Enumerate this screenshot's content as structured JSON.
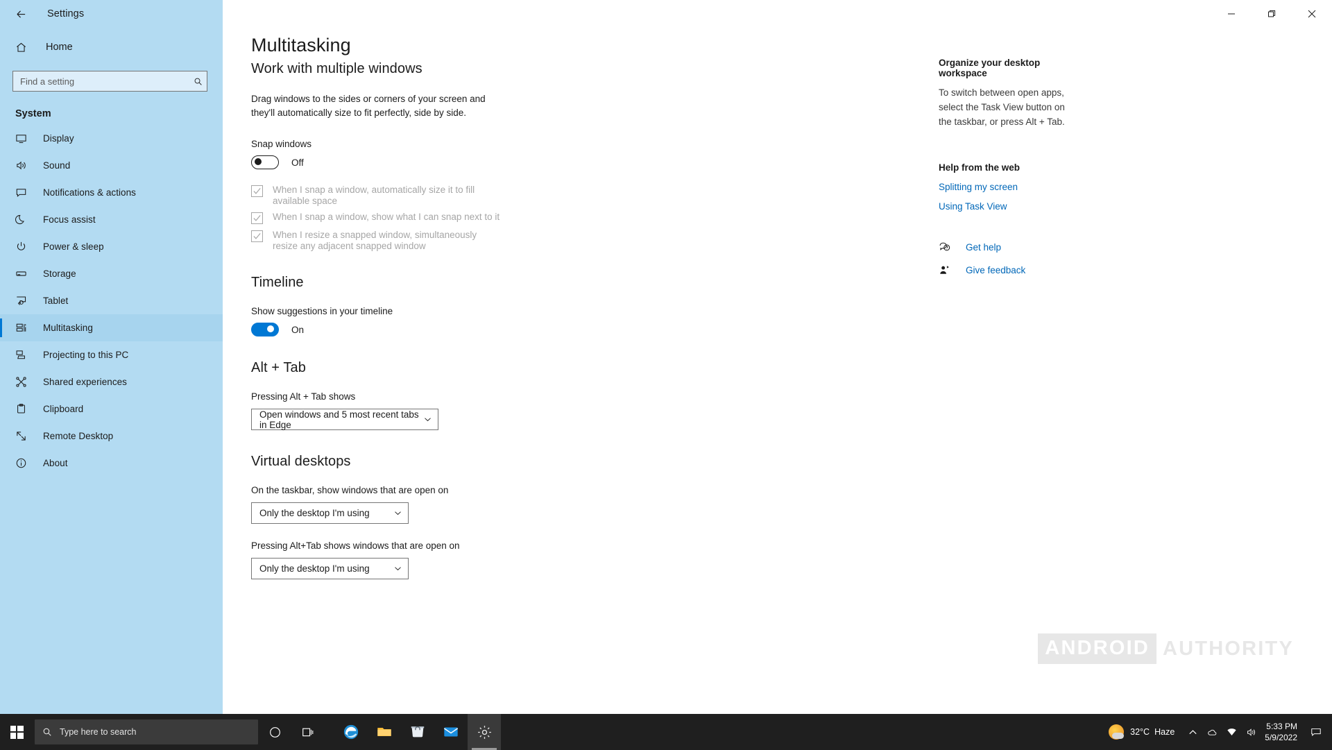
{
  "window": {
    "title": "Settings",
    "back_icon": "back-arrow-icon",
    "minimize_label": "Minimize",
    "restore_label": "Restore",
    "close_label": "Close"
  },
  "sidebar": {
    "home_label": "Home",
    "home_icon": "home-icon",
    "search": {
      "placeholder": "Find a setting",
      "value": "",
      "icon": "search-icon"
    },
    "group_title": "System",
    "items": [
      {
        "label": "Display",
        "icon": "monitor-icon",
        "selected": false
      },
      {
        "label": "Sound",
        "icon": "speaker-icon",
        "selected": false
      },
      {
        "label": "Notifications & actions",
        "icon": "notification-icon",
        "selected": false
      },
      {
        "label": "Focus assist",
        "icon": "moon-icon",
        "selected": false
      },
      {
        "label": "Power & sleep",
        "icon": "power-icon",
        "selected": false
      },
      {
        "label": "Storage",
        "icon": "storage-icon",
        "selected": false
      },
      {
        "label": "Tablet",
        "icon": "tablet-icon",
        "selected": false
      },
      {
        "label": "Multitasking",
        "icon": "multitasking-icon",
        "selected": true
      },
      {
        "label": "Projecting to this PC",
        "icon": "projecting-icon",
        "selected": false
      },
      {
        "label": "Shared experiences",
        "icon": "share-icon",
        "selected": false
      },
      {
        "label": "Clipboard",
        "icon": "clipboard-icon",
        "selected": false
      },
      {
        "label": "Remote Desktop",
        "icon": "remote-desktop-icon",
        "selected": false
      },
      {
        "label": "About",
        "icon": "info-icon",
        "selected": false
      }
    ]
  },
  "page": {
    "title": "Multitasking",
    "sections": {
      "work_with_multiple_windows": {
        "heading": "Work with multiple windows",
        "description": "Drag windows to the sides or corners of your screen and they'll automatically size to fit perfectly, side by side.",
        "snap_label": "Snap windows",
        "snap_state": "Off",
        "snap_on": false,
        "checkboxes": [
          {
            "label": "When I snap a window, automatically size it to fill available space",
            "checked": true,
            "disabled": true
          },
          {
            "label": "When I snap a window, show what I can snap next to it",
            "checked": true,
            "disabled": true
          },
          {
            "label": "When I resize a snapped window, simultaneously resize any adjacent snapped window",
            "checked": true,
            "disabled": true
          }
        ]
      },
      "timeline": {
        "heading": "Timeline",
        "label": "Show suggestions in your timeline",
        "state": "On",
        "on": true
      },
      "alt_tab": {
        "heading": "Alt + Tab",
        "label": "Pressing Alt + Tab shows",
        "value": "Open windows and 5 most recent tabs in Edge",
        "chevron_icon": "chevron-down-icon"
      },
      "virtual_desktops": {
        "heading": "Virtual desktops",
        "taskbar_label": "On the taskbar, show windows that are open on",
        "taskbar_value": "Only the desktop I'm using",
        "alttab_label": "Pressing Alt+Tab shows windows that are open on",
        "alttab_value": "Only the desktop I'm using",
        "chevron_icon": "chevron-down-icon"
      }
    }
  },
  "help_panel": {
    "heading": "Organize your desktop workspace",
    "body": "To switch between open apps, select the Task View button on the taskbar, or press Alt + Tab.",
    "web_heading": "Help from the web",
    "links": [
      "Splitting my screen",
      "Using Task View"
    ],
    "actions": [
      {
        "label": "Get help",
        "icon": "get-help-icon"
      },
      {
        "label": "Give feedback",
        "icon": "give-feedback-icon"
      }
    ]
  },
  "watermark": {
    "boxed": "ANDROID",
    "plain": "AUTHORITY"
  },
  "taskbar": {
    "start_label": "Start",
    "search_placeholder": "Type here to search",
    "cortana_label": "Cortana",
    "taskview_label": "Task View",
    "apps": [
      {
        "name": "edge-icon",
        "active": false
      },
      {
        "name": "file-explorer-icon",
        "active": false
      },
      {
        "name": "microsoft-store-icon",
        "active": false
      },
      {
        "name": "mail-icon",
        "active": false
      },
      {
        "name": "settings-icon",
        "active": true
      }
    ],
    "weather": {
      "temperature": "32°C",
      "condition": "Haze"
    },
    "tray": {
      "chevron_icon": "show-hidden-icons-icon",
      "onedrive_icon": "onedrive-icon",
      "network_icon": "network-icon",
      "volume_icon": "volume-icon"
    },
    "clock": {
      "time": "5:33 PM",
      "date": "5/9/2022"
    },
    "notifications_icon": "action-center-icon"
  },
  "colors": {
    "accent": "#0078d4",
    "sidebar": "#b3dbf2",
    "link": "#0067b8",
    "taskbar": "#1f1f1f",
    "disabled": "#a6a6a6"
  }
}
